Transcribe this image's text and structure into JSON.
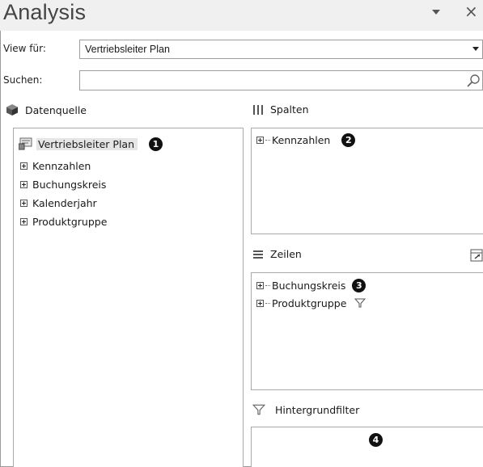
{
  "window": {
    "title": "Analysis"
  },
  "view": {
    "label": "View für:",
    "value": "Vertriebsleiter Plan"
  },
  "search": {
    "label": "Suchen:",
    "value": ""
  },
  "datasource": {
    "header": "Datenquelle",
    "root": "Vertriebsleiter Plan",
    "root_badge": "1",
    "items": [
      "Kennzahlen",
      "Buchungskreis",
      "Kalenderjahr",
      "Produktgruppe"
    ]
  },
  "columns": {
    "header": "Spalten",
    "items": [
      {
        "label": "Kennzahlen",
        "badge": "2"
      }
    ]
  },
  "rows": {
    "header": "Zeilen",
    "items": [
      {
        "label": "Buchungskreis",
        "badge": "3"
      },
      {
        "label": "Produktgruppe"
      }
    ]
  },
  "background_filter": {
    "header": "Hintergrundfilter",
    "badge": "4"
  }
}
